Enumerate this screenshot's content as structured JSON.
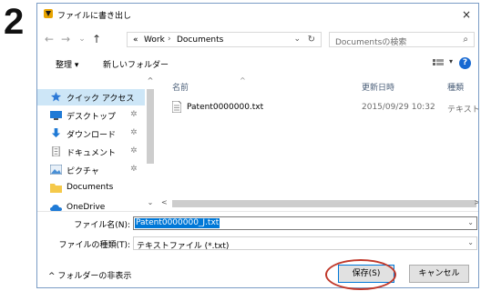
{
  "step_number": "2",
  "window": {
    "title": "ファイルに書き出し",
    "close_symbol": "×"
  },
  "nav": {
    "back_symbol": "←",
    "forward_symbol": "→",
    "recent_symbol": "⌄",
    "up_symbol": "↑",
    "overflow_symbol": "«",
    "breadcrumbs": [
      "Work",
      "Documents"
    ],
    "breadcrumb_sep": "›",
    "dropdown_symbol": "⌄",
    "refresh_symbol": "↻"
  },
  "search": {
    "placeholder": "Documentsの検索",
    "icon_symbol": "⌕"
  },
  "toolbar": {
    "organize_label": "整理 ▾",
    "new_folder_label": "新しいフォルダー",
    "view_dropdown_symbol": "▾",
    "help_symbol": "?"
  },
  "nav_pane": {
    "items": [
      {
        "label": "クイック アクセス",
        "icon": "star-icon",
        "pinned": false
      },
      {
        "label": "デスクトップ",
        "icon": "desktop-icon",
        "pinned": true
      },
      {
        "label": "ダウンロード",
        "icon": "download-icon",
        "pinned": true
      },
      {
        "label": "ドキュメント",
        "icon": "documents-icon",
        "pinned": true
      },
      {
        "label": "ピクチャ",
        "icon": "pictures-icon",
        "pinned": true
      },
      {
        "label": "Documents",
        "icon": "folder-icon",
        "pinned": false
      },
      {
        "label": "OneDrive",
        "icon": "onedrive-icon",
        "pinned": false
      }
    ],
    "pin_symbol": "✲",
    "scroll_up_symbol": "^",
    "scroll_down_symbol": "⌄"
  },
  "file_list": {
    "columns": [
      "名前",
      "更新日時",
      "種類"
    ],
    "sort_symbol": "^",
    "rows": [
      {
        "name": "Patent0000000.txt",
        "modified": "2015/09/29 10:32",
        "type": "テキストド"
      }
    ],
    "scroll_left_symbol": "<",
    "scroll_right_symbol": ">"
  },
  "form": {
    "filename_label": "ファイル名(N):",
    "filename_value": "Patent0000000_J.txt",
    "filetype_label": "ファイルの種類(T):",
    "filetype_value": "テキストファイル (*.txt)",
    "dropdown_symbol": "⌄"
  },
  "footer": {
    "hide_folders_label": "^ フォルダーの非表示",
    "save_label": "保存(S)",
    "cancel_label": "キャンセル"
  },
  "colors": {
    "accent": "#0078d7",
    "highlight_circle": "#c0392b",
    "help_button": "#1769d2",
    "selected_nav": "#cde6f7"
  }
}
